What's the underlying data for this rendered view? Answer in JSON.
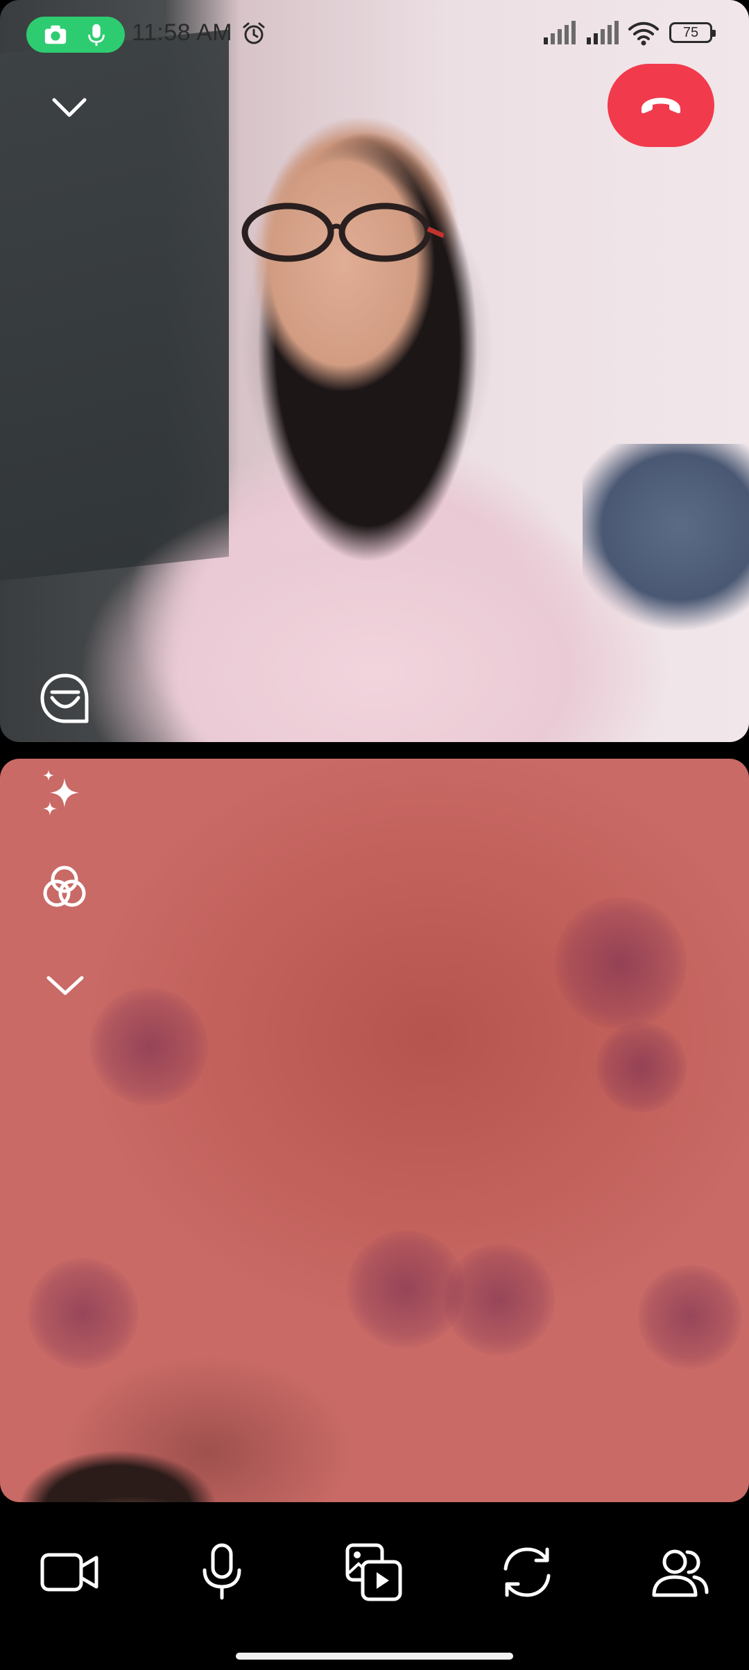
{
  "status_bar": {
    "time": "11:58 AM",
    "battery": "75",
    "indicators": [
      "camera-icon",
      "microphone-icon",
      "alarm-icon",
      "signal-icon",
      "signal-icon",
      "wifi-icon",
      "battery-icon"
    ],
    "pill_color": "#2ecc71"
  },
  "call": {
    "end_call_color": "#f23a4d",
    "remote_controls": [
      "collapse-chevron-icon",
      "end-call-icon",
      "reactions-icon"
    ],
    "local_controls": [
      "effects-sparkles-icon",
      "filters-icon",
      "collapse-chevron-icon"
    ]
  },
  "toolbar": {
    "buttons": [
      "video-camera-icon",
      "microphone-icon",
      "share-media-icon",
      "flip-camera-icon",
      "participants-icon"
    ]
  }
}
